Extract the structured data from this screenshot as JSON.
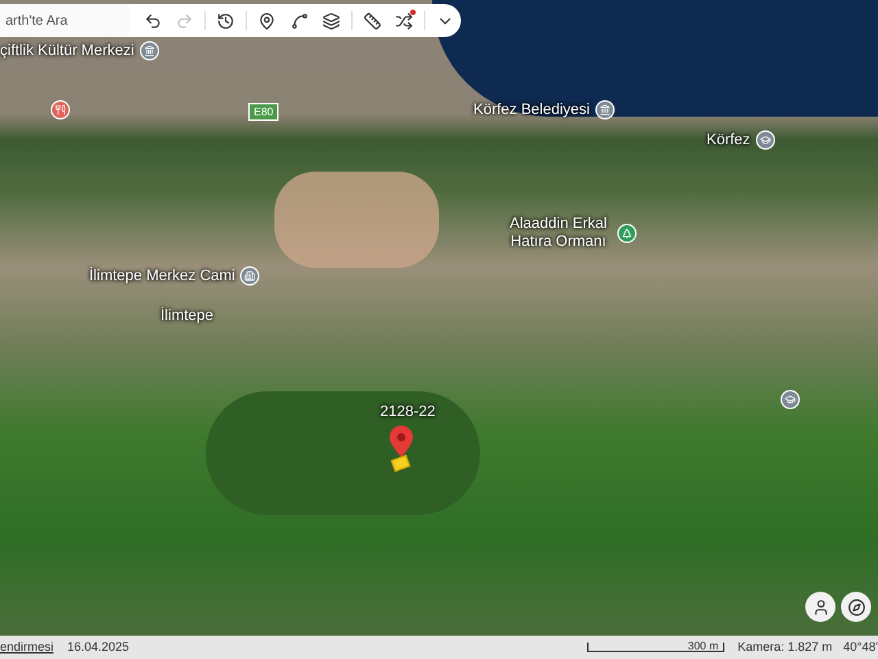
{
  "search": {
    "placeholder": "arth'te Ara"
  },
  "toolbar": [
    {
      "kind": "undo",
      "disabled": false
    },
    {
      "kind": "redo",
      "disabled": true
    },
    {
      "kind": "history",
      "disabled": false
    },
    {
      "kind": "pin",
      "disabled": false
    },
    {
      "kind": "path",
      "disabled": false
    },
    {
      "kind": "layers",
      "disabled": false
    },
    {
      "kind": "ruler",
      "disabled": false
    },
    {
      "kind": "tools",
      "disabled": false
    },
    {
      "kind": "more",
      "disabled": false
    }
  ],
  "map_labels": [
    {
      "text": "çiftlik Kültür Merkezi",
      "kind": "culture"
    },
    {
      "text": "Körfez Belediyesi",
      "kind": "government"
    },
    {
      "text": "Körfez",
      "kind": "school"
    },
    {
      "text": "Alaaddin Erkal Hatıra Ormanı",
      "kind": "park"
    },
    {
      "text": "İlimtepe Merkez Cami",
      "kind": "mosque"
    },
    {
      "text": "İlimtepe",
      "kind": "plain"
    }
  ],
  "road_sign": {
    "text": "E80"
  },
  "placemark": {
    "text": "2128-22"
  },
  "status_bar": {
    "link": "endirmesi",
    "date": "16.04.2025",
    "scale": "300 m",
    "camera": "Kamera: 1.827 m",
    "coords": "40°48'"
  }
}
